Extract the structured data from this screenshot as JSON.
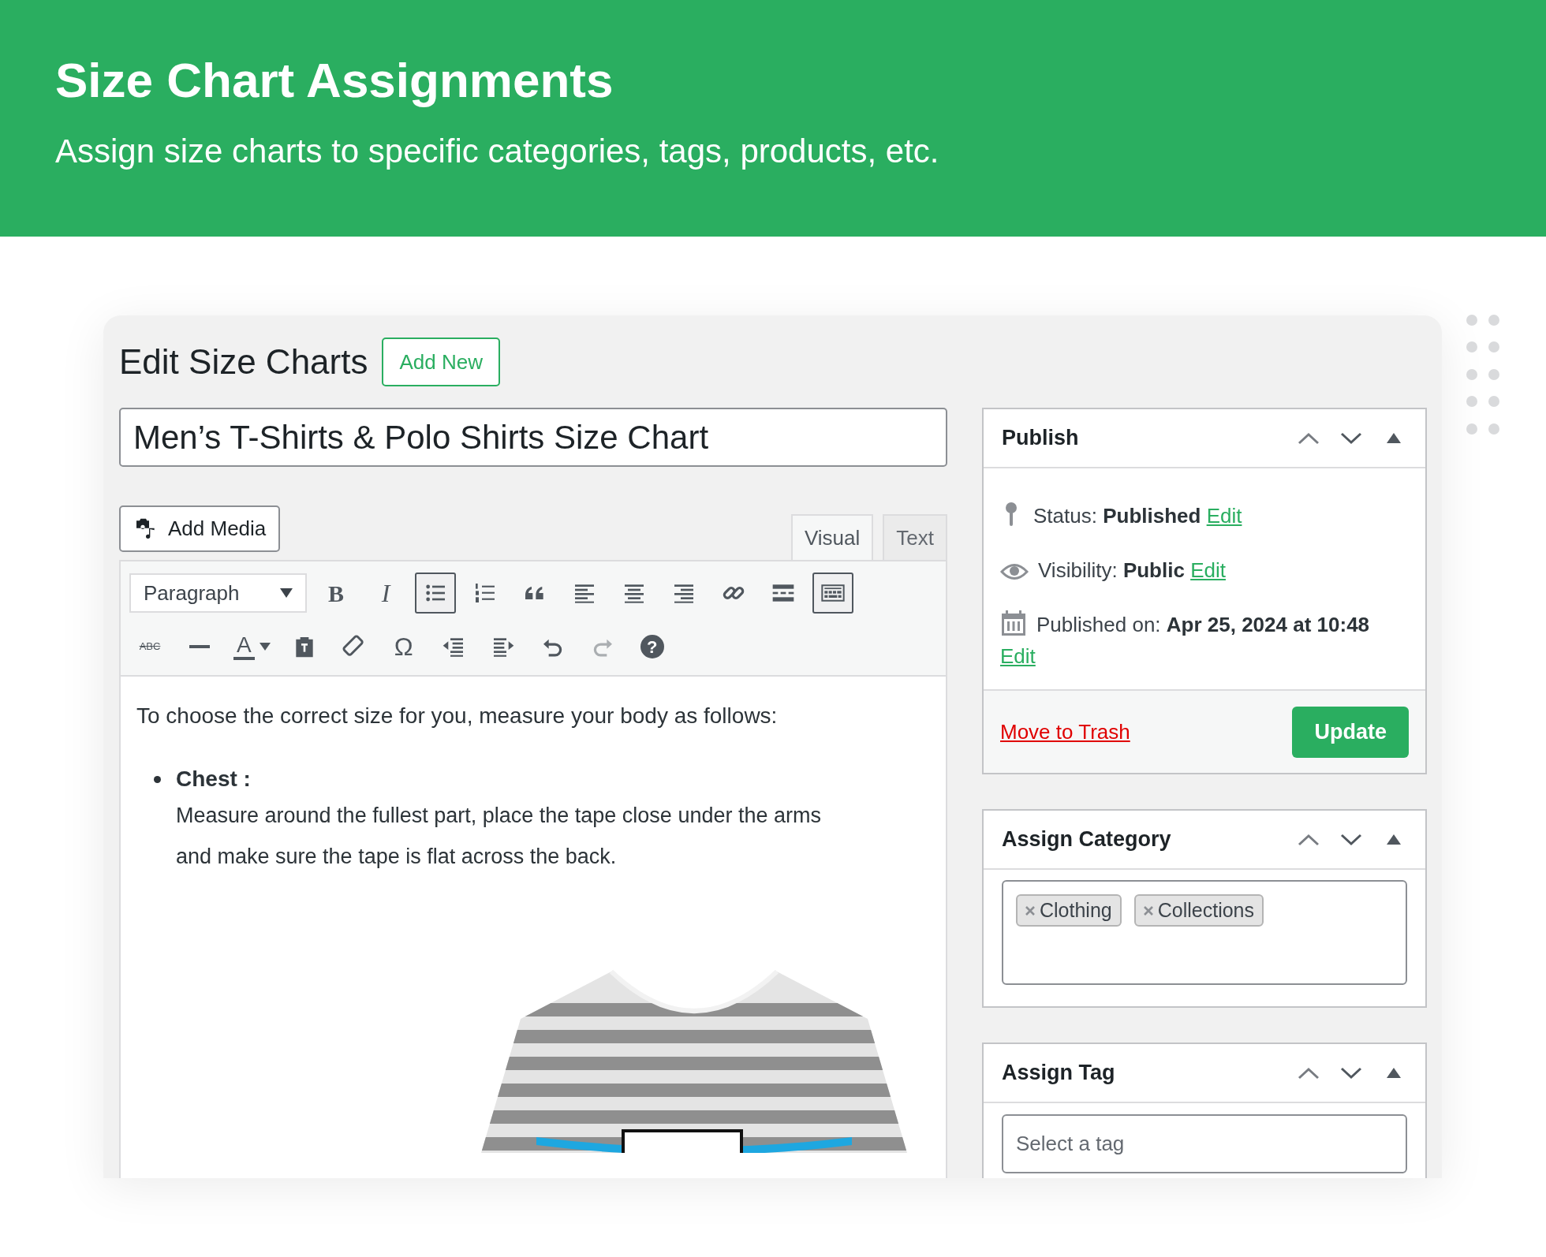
{
  "banner": {
    "title": "Size Chart Assignments",
    "subtitle": "Assign size charts to specific categories, tags, products, etc."
  },
  "page": {
    "heading": "Edit Size Charts",
    "add_new": "Add New"
  },
  "post_title": {
    "value": "Men’s T-Shirts & Polo Shirts Size Chart"
  },
  "editor": {
    "add_media": "Add Media",
    "tabs": [
      {
        "label": "Visual",
        "selected": true
      },
      {
        "label": "Text",
        "selected": false
      }
    ],
    "format_select": "Paragraph",
    "toolbar_rows": [
      {
        "tools": [
          {
            "kind": "bold",
            "label": "B",
            "active": false,
            "disabled": false
          },
          {
            "kind": "italic",
            "label": "I",
            "active": false,
            "disabled": false
          },
          {
            "kind": "bullet_list",
            "active": true,
            "disabled": false
          },
          {
            "kind": "numbered_list",
            "active": false,
            "disabled": false
          },
          {
            "kind": "quote",
            "active": false,
            "disabled": false
          },
          {
            "kind": "align_left",
            "active": false,
            "disabled": false
          },
          {
            "kind": "align_center",
            "active": false,
            "disabled": false
          },
          {
            "kind": "align_right",
            "active": false,
            "disabled": false
          },
          {
            "kind": "link",
            "active": false,
            "disabled": false
          },
          {
            "kind": "read_more",
            "active": false,
            "disabled": false
          },
          {
            "kind": "toolbar_toggle",
            "active": true,
            "disabled": false
          }
        ]
      },
      {
        "tools": [
          {
            "kind": "strikethrough",
            "label": "ABC",
            "active": false,
            "disabled": false
          },
          {
            "kind": "horizontal_line",
            "active": false,
            "disabled": false
          },
          {
            "kind": "text_color",
            "label": "A",
            "active": false,
            "disabled": false
          },
          {
            "kind": "paste_text",
            "active": false,
            "disabled": false
          },
          {
            "kind": "clear_format",
            "active": false,
            "disabled": false
          },
          {
            "kind": "special_char",
            "label": "Ω",
            "active": false,
            "disabled": false
          },
          {
            "kind": "outdent",
            "active": false,
            "disabled": false
          },
          {
            "kind": "indent",
            "active": false,
            "disabled": false
          },
          {
            "kind": "undo",
            "active": false,
            "disabled": false
          },
          {
            "kind": "redo",
            "active": false,
            "disabled": true
          },
          {
            "kind": "help",
            "label": "?",
            "active": false,
            "disabled": false
          }
        ]
      }
    ],
    "content": {
      "intro": "To choose the correct size for you, measure your body as follows:",
      "list": [
        {
          "term": "Chest :",
          "text": "Measure around the fullest part, place the tape close under the arms and make sure the tape is flat across the back."
        }
      ]
    }
  },
  "sidebar": {
    "publish": {
      "title": "Publish",
      "rows": [
        {
          "kind": "status",
          "label": "Status:",
          "value": "Published",
          "link": "Edit"
        },
        {
          "kind": "visibility",
          "label": "Visibility:",
          "value": "Public",
          "link": "Edit"
        },
        {
          "kind": "date",
          "label": "Published on:",
          "value": "Apr 25, 2024 at 10:48",
          "link": "Edit"
        }
      ],
      "trash": "Move to Trash",
      "update": "Update"
    },
    "category": {
      "title": "Assign Category",
      "chips": [
        {
          "label": "Clothing"
        },
        {
          "label": "Collections"
        }
      ]
    },
    "tag": {
      "title": "Assign Tag",
      "placeholder": "Select a tag"
    }
  }
}
